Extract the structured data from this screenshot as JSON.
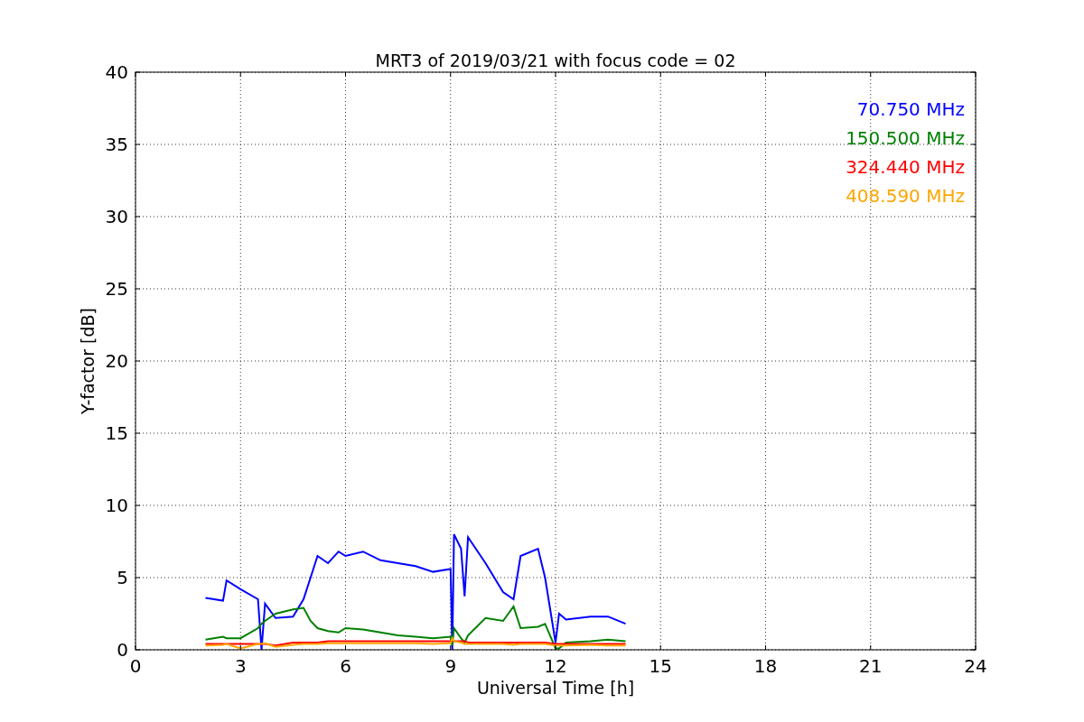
{
  "chart": {
    "chart_data": {
      "type": "line",
      "title": "MRT3 of 2019/03/21 with focus code = 02",
      "xlabel": "Universal Time [h]",
      "ylabel": "Y-factor [dB]",
      "x": [
        2,
        2.5,
        2.6,
        3,
        3.5,
        3.6,
        3.7,
        4,
        4.5,
        4.8,
        5,
        5.2,
        5.5,
        5.8,
        6,
        6.5,
        7,
        7.5,
        8,
        8.5,
        9,
        9.05,
        9.1,
        9.3,
        9.4,
        9.5,
        10,
        10.5,
        10.8,
        11,
        11.5,
        11.7,
        12,
        12.1,
        12.3,
        13,
        13.5,
        14
      ],
      "series": [
        {
          "name": "70.750 MHz",
          "color": "#0000ff",
          "values": [
            3.6,
            3.4,
            4.8,
            4.2,
            3.5,
            0,
            3.2,
            2.2,
            2.3,
            3.5,
            5,
            6.5,
            6,
            6.8,
            6.5,
            6.8,
            6.2,
            6,
            5.8,
            5.4,
            5.6,
            0,
            8,
            7,
            3.7,
            7.8,
            6,
            4,
            3.5,
            6.5,
            7,
            5,
            0.5,
            2.5,
            2.1,
            2.3,
            2.3,
            1.8
          ]
        },
        {
          "name": "150.500 MHz",
          "color": "#008000",
          "values": [
            0.7,
            0.9,
            0.8,
            0.8,
            1.5,
            1.8,
            2,
            2.5,
            2.8,
            2.9,
            2,
            1.5,
            1.3,
            1.2,
            1.5,
            1.4,
            1.2,
            1,
            0.9,
            0.8,
            0.9,
            0.3,
            1.5,
            0.8,
            0.5,
            1,
            2.2,
            2,
            3,
            1.5,
            1.6,
            1.8,
            0.1,
            0.1,
            0.5,
            0.6,
            0.7,
            0.6
          ]
        },
        {
          "name": "324.440 MHz",
          "color": "#ff0000",
          "values": [
            0.4,
            0.4,
            0.4,
            0.4,
            0.4,
            0.4,
            0.4,
            0.3,
            0.5,
            0.5,
            0.5,
            0.5,
            0.6,
            0.6,
            0.6,
            0.6,
            0.6,
            0.6,
            0.6,
            0.6,
            0.6,
            0.7,
            0.6,
            0.6,
            0.6,
            0.5,
            0.5,
            0.5,
            0.5,
            0.5,
            0.5,
            0.5,
            0.4,
            0.4,
            0.4,
            0.4,
            0.4,
            0.4
          ]
        },
        {
          "name": "408.590 MHz",
          "color": "#ffa500",
          "values": [
            0.3,
            0.35,
            0.4,
            0.1,
            0.4,
            0.4,
            0.45,
            0.2,
            0.35,
            0.4,
            0.4,
            0.4,
            0.45,
            0.45,
            0.45,
            0.45,
            0.45,
            0.45,
            0.45,
            0.4,
            0.45,
            0.8,
            0.6,
            0.5,
            0.4,
            0.4,
            0.4,
            0.4,
            0.35,
            0.4,
            0.4,
            0.4,
            0.3,
            0.3,
            0.3,
            0.35,
            0.3,
            0.3
          ]
        }
      ],
      "grid": true,
      "xlim": [
        0,
        24
      ],
      "ylim": [
        0,
        40
      ],
      "xticks": [
        0,
        3,
        6,
        9,
        12,
        15,
        18,
        21,
        24
      ],
      "yticks": [
        0,
        5,
        10,
        15,
        20,
        25,
        30,
        35,
        40
      ]
    }
  }
}
